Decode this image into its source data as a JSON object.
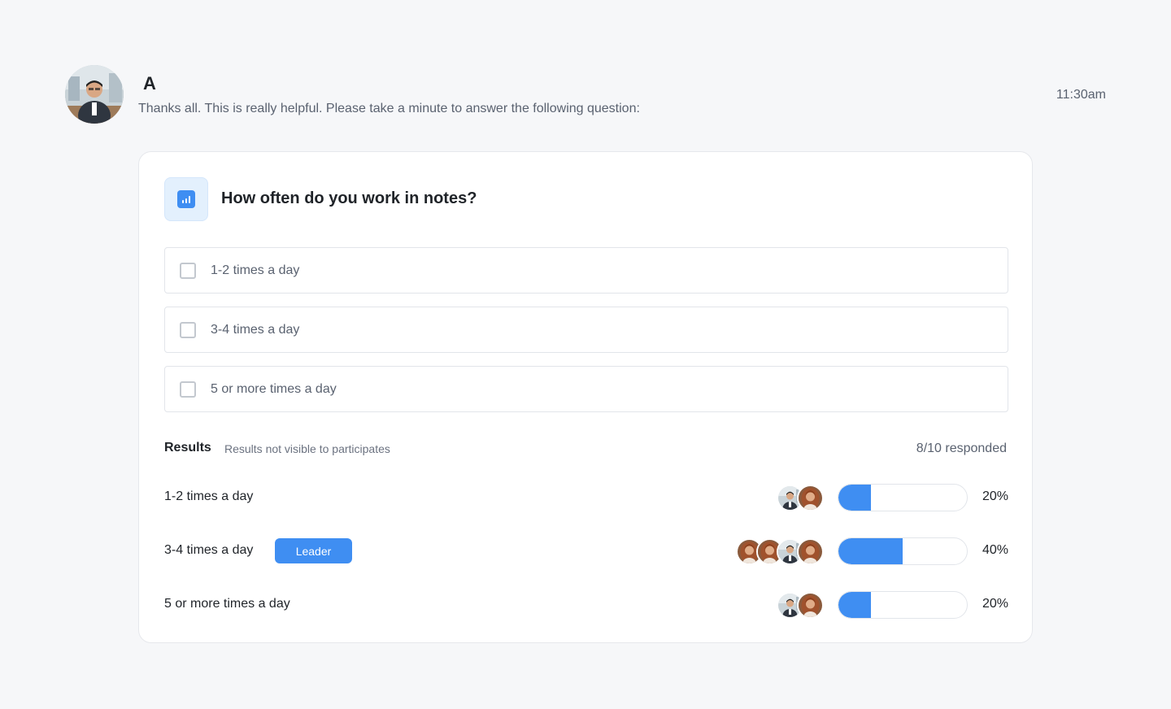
{
  "message": {
    "sender": "A",
    "text": "Thanks all. This is really helpful. Please take a minute to answer the following question:",
    "timestamp": "11:30am"
  },
  "poll": {
    "question": "How often do you work in notes?",
    "options": [
      {
        "label": "1-2 times a day"
      },
      {
        "label": "3-4 times a day"
      },
      {
        "label": "5 or more times a day"
      }
    ],
    "results_title": "Results",
    "results_note": "Results not visible to participates",
    "responded": "8/10 responded",
    "results": [
      {
        "label": "1-2 times a day",
        "percent_text": "20%",
        "fraction": 0.2,
        "avatars": [
          "man",
          "woman"
        ],
        "leader": ""
      },
      {
        "label": "3-4 times a day",
        "percent_text": "40%",
        "fraction": 0.4,
        "avatars": [
          "woman",
          "woman",
          "man",
          "woman"
        ],
        "leader": "Leader"
      },
      {
        "label": "5 or more times a day",
        "percent_text": "20%",
        "fraction": 0.2,
        "avatars": [
          "man",
          "woman"
        ],
        "leader": ""
      }
    ]
  },
  "colors": {
    "accent": "#3f8ef2",
    "background": "#f6f7f9",
    "card": "#ffffff",
    "muted_text": "#5a6270"
  }
}
